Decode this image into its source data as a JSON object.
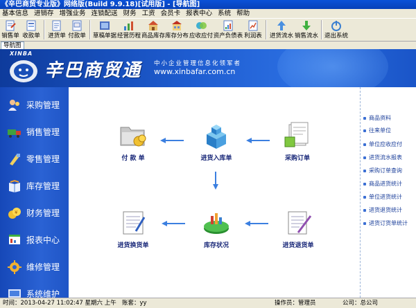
{
  "window": {
    "title": "《辛巴商贸专业版》网络版(Build 9.9.18)[试用版] - [导航图]"
  },
  "menubar": {
    "items": [
      "基本信息",
      "进销存",
      "增强业务",
      "连锁配送",
      "财务",
      "工资",
      "会员卡",
      "报表中心",
      "系统",
      "帮助"
    ]
  },
  "toolbar": {
    "buttons": [
      "销售单",
      "收款单",
      "进货单",
      "付款单",
      "草稿单据",
      "经营历程",
      "商品库存",
      "库存分布",
      "应收应付",
      "资产负债表",
      "利润表",
      "进货流水",
      "销售流水",
      "退出系统"
    ]
  },
  "tabs": {
    "nav": "导航图"
  },
  "banner": {
    "brand_en": "XINBA",
    "brand_cn": "辛巴商贸通",
    "slogan": "中小企业管理信息化领军者",
    "url": "www.xinbafar.com.cn"
  },
  "leftnav": {
    "items": [
      "采购管理",
      "销售管理",
      "零售管理",
      "库存管理",
      "财务管理",
      "报表中心",
      "维修管理",
      "系统维护"
    ]
  },
  "flow": {
    "payment": "付 款 单",
    "purchase_in": "进货入库单",
    "purchase_order": "采购订单",
    "purchase_exchange": "进货换货单",
    "stock_status": "库存状况",
    "purchase_return": "进货退货单"
  },
  "rightpanel": {
    "links": [
      "商品资料",
      "往来单位",
      "单位应收应付",
      "进货流水报表",
      "采购订单查询",
      "商品进货统计",
      "单位进货统计",
      "进货退货统计",
      "进货订货单统计"
    ]
  },
  "statusbar": {
    "time_label": "时间：",
    "time_value": "2013-04-27 11:02:47 星期六 上午",
    "account_label": "账套：",
    "account_value": "yy",
    "operator_label": "操作员：",
    "operator_value": "管理员",
    "company_label": "公司：",
    "company_value": "总公司"
  },
  "colors": {
    "title_bar": "#0a52d8",
    "banner": "#1e5cd0",
    "leftnav": "#2a62d4",
    "flow_label": "#1b2a7a",
    "arrow": "#3b7fe0"
  }
}
